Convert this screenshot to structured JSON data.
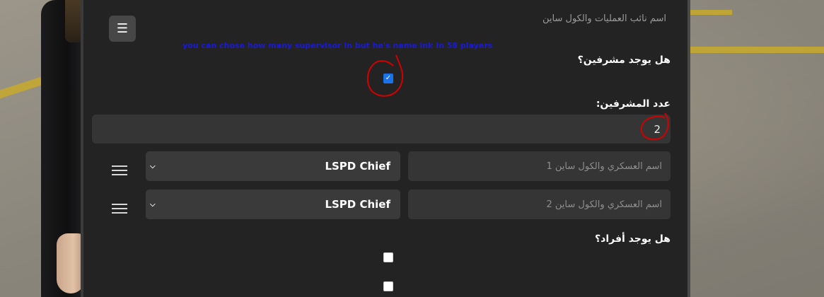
{
  "header": {
    "menu_icon": "hamburger-icon",
    "subtitle": "اسم نائب العمليات والكول ساين"
  },
  "annotation": {
    "note": "you can chose how many supervisor in but he's name ink in 58 players",
    "circle_color": "#d40000"
  },
  "supervisors": {
    "question": "هل يوجد مشرفين؟",
    "checked": true
  },
  "count": {
    "label": "عدد المشرفين:",
    "value": "2"
  },
  "rows": [
    {
      "rank": "LSPD Chief",
      "placeholder": "اسم العسكري والكول ساين 1"
    },
    {
      "rank": "LSPD Chief",
      "placeholder": "اسم العسكري والكول ساين 2"
    }
  ],
  "members": {
    "question": "هل يوجد أفراد؟",
    "checked": false
  },
  "colors": {
    "panel_bg": "#232323",
    "field_bg": "#353535",
    "accent": "#1a73e8"
  }
}
